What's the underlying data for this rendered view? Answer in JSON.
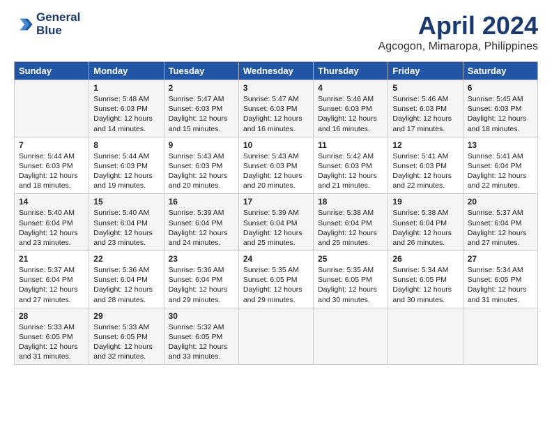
{
  "header": {
    "logo_line1": "General",
    "logo_line2": "Blue",
    "month_year": "April 2024",
    "location": "Agcogon, Mimaropa, Philippines"
  },
  "days_of_week": [
    "Sunday",
    "Monday",
    "Tuesday",
    "Wednesday",
    "Thursday",
    "Friday",
    "Saturday"
  ],
  "weeks": [
    [
      {
        "day": "",
        "sunrise": "",
        "sunset": "",
        "daylight": ""
      },
      {
        "day": "1",
        "sunrise": "Sunrise: 5:48 AM",
        "sunset": "Sunset: 6:03 PM",
        "daylight": "Daylight: 12 hours and 14 minutes."
      },
      {
        "day": "2",
        "sunrise": "Sunrise: 5:47 AM",
        "sunset": "Sunset: 6:03 PM",
        "daylight": "Daylight: 12 hours and 15 minutes."
      },
      {
        "day": "3",
        "sunrise": "Sunrise: 5:47 AM",
        "sunset": "Sunset: 6:03 PM",
        "daylight": "Daylight: 12 hours and 16 minutes."
      },
      {
        "day": "4",
        "sunrise": "Sunrise: 5:46 AM",
        "sunset": "Sunset: 6:03 PM",
        "daylight": "Daylight: 12 hours and 16 minutes."
      },
      {
        "day": "5",
        "sunrise": "Sunrise: 5:46 AM",
        "sunset": "Sunset: 6:03 PM",
        "daylight": "Daylight: 12 hours and 17 minutes."
      },
      {
        "day": "6",
        "sunrise": "Sunrise: 5:45 AM",
        "sunset": "Sunset: 6:03 PM",
        "daylight": "Daylight: 12 hours and 18 minutes."
      }
    ],
    [
      {
        "day": "7",
        "sunrise": "Sunrise: 5:44 AM",
        "sunset": "Sunset: 6:03 PM",
        "daylight": "Daylight: 12 hours and 18 minutes."
      },
      {
        "day": "8",
        "sunrise": "Sunrise: 5:44 AM",
        "sunset": "Sunset: 6:03 PM",
        "daylight": "Daylight: 12 hours and 19 minutes."
      },
      {
        "day": "9",
        "sunrise": "Sunrise: 5:43 AM",
        "sunset": "Sunset: 6:03 PM",
        "daylight": "Daylight: 12 hours and 20 minutes."
      },
      {
        "day": "10",
        "sunrise": "Sunrise: 5:43 AM",
        "sunset": "Sunset: 6:03 PM",
        "daylight": "Daylight: 12 hours and 20 minutes."
      },
      {
        "day": "11",
        "sunrise": "Sunrise: 5:42 AM",
        "sunset": "Sunset: 6:03 PM",
        "daylight": "Daylight: 12 hours and 21 minutes."
      },
      {
        "day": "12",
        "sunrise": "Sunrise: 5:41 AM",
        "sunset": "Sunset: 6:03 PM",
        "daylight": "Daylight: 12 hours and 22 minutes."
      },
      {
        "day": "13",
        "sunrise": "Sunrise: 5:41 AM",
        "sunset": "Sunset: 6:04 PM",
        "daylight": "Daylight: 12 hours and 22 minutes."
      }
    ],
    [
      {
        "day": "14",
        "sunrise": "Sunrise: 5:40 AM",
        "sunset": "Sunset: 6:04 PM",
        "daylight": "Daylight: 12 hours and 23 minutes."
      },
      {
        "day": "15",
        "sunrise": "Sunrise: 5:40 AM",
        "sunset": "Sunset: 6:04 PM",
        "daylight": "Daylight: 12 hours and 23 minutes."
      },
      {
        "day": "16",
        "sunrise": "Sunrise: 5:39 AM",
        "sunset": "Sunset: 6:04 PM",
        "daylight": "Daylight: 12 hours and 24 minutes."
      },
      {
        "day": "17",
        "sunrise": "Sunrise: 5:39 AM",
        "sunset": "Sunset: 6:04 PM",
        "daylight": "Daylight: 12 hours and 25 minutes."
      },
      {
        "day": "18",
        "sunrise": "Sunrise: 5:38 AM",
        "sunset": "Sunset: 6:04 PM",
        "daylight": "Daylight: 12 hours and 25 minutes."
      },
      {
        "day": "19",
        "sunrise": "Sunrise: 5:38 AM",
        "sunset": "Sunset: 6:04 PM",
        "daylight": "Daylight: 12 hours and 26 minutes."
      },
      {
        "day": "20",
        "sunrise": "Sunrise: 5:37 AM",
        "sunset": "Sunset: 6:04 PM",
        "daylight": "Daylight: 12 hours and 27 minutes."
      }
    ],
    [
      {
        "day": "21",
        "sunrise": "Sunrise: 5:37 AM",
        "sunset": "Sunset: 6:04 PM",
        "daylight": "Daylight: 12 hours and 27 minutes."
      },
      {
        "day": "22",
        "sunrise": "Sunrise: 5:36 AM",
        "sunset": "Sunset: 6:04 PM",
        "daylight": "Daylight: 12 hours and 28 minutes."
      },
      {
        "day": "23",
        "sunrise": "Sunrise: 5:36 AM",
        "sunset": "Sunset: 6:04 PM",
        "daylight": "Daylight: 12 hours and 29 minutes."
      },
      {
        "day": "24",
        "sunrise": "Sunrise: 5:35 AM",
        "sunset": "Sunset: 6:05 PM",
        "daylight": "Daylight: 12 hours and 29 minutes."
      },
      {
        "day": "25",
        "sunrise": "Sunrise: 5:35 AM",
        "sunset": "Sunset: 6:05 PM",
        "daylight": "Daylight: 12 hours and 30 minutes."
      },
      {
        "day": "26",
        "sunrise": "Sunrise: 5:34 AM",
        "sunset": "Sunset: 6:05 PM",
        "daylight": "Daylight: 12 hours and 30 minutes."
      },
      {
        "day": "27",
        "sunrise": "Sunrise: 5:34 AM",
        "sunset": "Sunset: 6:05 PM",
        "daylight": "Daylight: 12 hours and 31 minutes."
      }
    ],
    [
      {
        "day": "28",
        "sunrise": "Sunrise: 5:33 AM",
        "sunset": "Sunset: 6:05 PM",
        "daylight": "Daylight: 12 hours and 31 minutes."
      },
      {
        "day": "29",
        "sunrise": "Sunrise: 5:33 AM",
        "sunset": "Sunset: 6:05 PM",
        "daylight": "Daylight: 12 hours and 32 minutes."
      },
      {
        "day": "30",
        "sunrise": "Sunrise: 5:32 AM",
        "sunset": "Sunset: 6:05 PM",
        "daylight": "Daylight: 12 hours and 33 minutes."
      },
      {
        "day": "",
        "sunrise": "",
        "sunset": "",
        "daylight": ""
      },
      {
        "day": "",
        "sunrise": "",
        "sunset": "",
        "daylight": ""
      },
      {
        "day": "",
        "sunrise": "",
        "sunset": "",
        "daylight": ""
      },
      {
        "day": "",
        "sunrise": "",
        "sunset": "",
        "daylight": ""
      }
    ]
  ]
}
